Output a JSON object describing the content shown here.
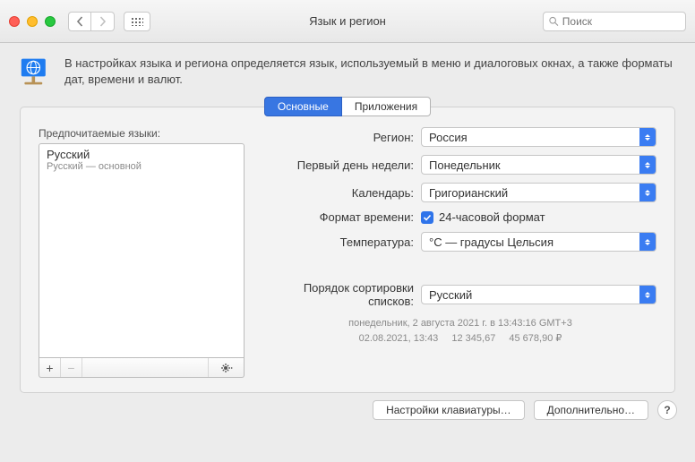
{
  "window": {
    "title": "Язык и регион"
  },
  "search": {
    "placeholder": "Поиск"
  },
  "header": {
    "text": "В настройках языка и региона определяется язык, используемый в меню и диалоговых окнах, а также форматы дат, времени и валют."
  },
  "tabs": {
    "general": "Основные",
    "apps": "Приложения"
  },
  "preferred": {
    "label": "Предпочитаемые языки:",
    "lang_name": "Русский",
    "lang_sub": "Русский — основной"
  },
  "settings": {
    "region_label": "Регион:",
    "region_value": "Россия",
    "firstday_label": "Первый день недели:",
    "firstday_value": "Понедельник",
    "calendar_label": "Календарь:",
    "calendar_value": "Григорианский",
    "timefmt_label": "Формат времени:",
    "timefmt_value": "24-часовой формат",
    "temp_label": "Температура:",
    "temp_value": "°C — градусы Цельсия",
    "sort_label": "Порядок сортировки списков:",
    "sort_value": "Русский"
  },
  "example": {
    "line1": "понедельник, 2 августа 2021 г. в 13:43:16 GMT+3",
    "date": "02.08.2021, 13:43",
    "num": "12 345,67",
    "currency": "45 678,90 ₽"
  },
  "buttons": {
    "keyboard": "Настройки клавиатуры…",
    "advanced": "Дополнительно…",
    "help": "?"
  }
}
